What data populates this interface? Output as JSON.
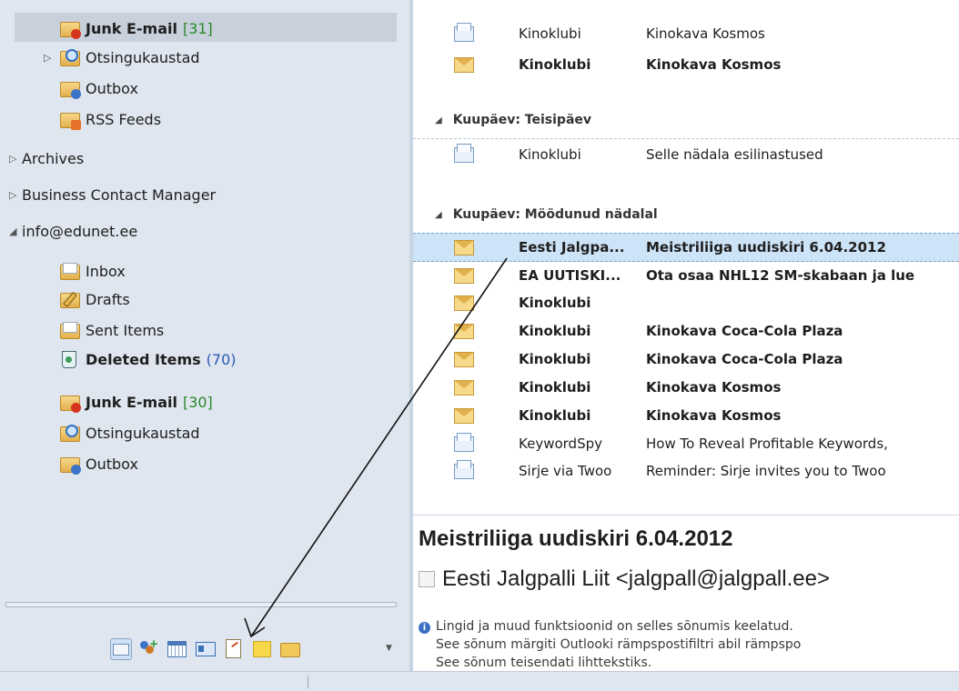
{
  "nav": {
    "folders_top": [
      {
        "label": "Junk E-mail",
        "count": "[31]"
      },
      {
        "label": "Otsingukaustad"
      },
      {
        "label": "Outbox"
      },
      {
        "label": "RSS Feeds"
      }
    ],
    "groups": [
      "Archives",
      "Business Contact Manager",
      "info@edunet.ee"
    ],
    "folders_info": [
      {
        "label": "Inbox"
      },
      {
        "label": "Drafts"
      },
      {
        "label": "Sent Items"
      },
      {
        "label": "Deleted Items",
        "count": "(70)"
      },
      {
        "label": "Junk E-mail",
        "count": "[30]"
      },
      {
        "label": "Otsingukaustad"
      },
      {
        "label": "Outbox"
      }
    ],
    "buttons": [
      "mail-icon",
      "contacts-icon",
      "calendar-icon",
      "contact-card-icon",
      "tasks-icon",
      "notes-icon",
      "folder-icon",
      "more-arrow-icon"
    ]
  },
  "list": {
    "groups": [
      "Kuupäev: Teisipäev",
      "Kuupäev: Möödunud nädalal"
    ],
    "rows_top": [
      {
        "from": "Kinoklubi",
        "subject": "Kinokava Kosmos"
      },
      {
        "from": "Kinoklubi",
        "subject": "Kinokava Kosmos"
      }
    ],
    "rows_tuesday": [
      {
        "from": "Kinoklubi",
        "subject": "Selle nädala esilinastused"
      }
    ],
    "rows_lastweek": [
      {
        "from": "Eesti Jalgpa...",
        "subject": "Meistriliiga uudiskiri 6.04.2012"
      },
      {
        "from": "EA UUTISKI...",
        "subject": "Ota osaa NHL12 SM-skabaan ja lue"
      },
      {
        "from": "Kinoklubi",
        "subject": ""
      },
      {
        "from": "Kinoklubi",
        "subject": "Kinokava Coca-Cola Plaza"
      },
      {
        "from": "Kinoklubi",
        "subject": "Kinokava Coca-Cola Plaza"
      },
      {
        "from": "Kinoklubi",
        "subject": "Kinokava Kosmos"
      },
      {
        "from": "Kinoklubi",
        "subject": "Kinokava Kosmos"
      },
      {
        "from": "KeywordSpy",
        "subject": "How To Reveal Profitable Keywords,"
      },
      {
        "from": "Sirje via Twoo",
        "subject": "Reminder: Sirje invites you to Twoo"
      }
    ]
  },
  "reading": {
    "subject": "Meistriliiga uudiskiri 6.04.2012",
    "sender": "Eesti Jalgpalli Liit <jalgpall@jalgpall.ee>",
    "info_lines": [
      "Lingid ja muud funktsioonid on selles sõnumis keelatud.",
      "See sõnum märgiti Outlooki rämpspostifiltri abil rämpspo",
      "See sõnum teisendati lihttekstiks."
    ]
  }
}
